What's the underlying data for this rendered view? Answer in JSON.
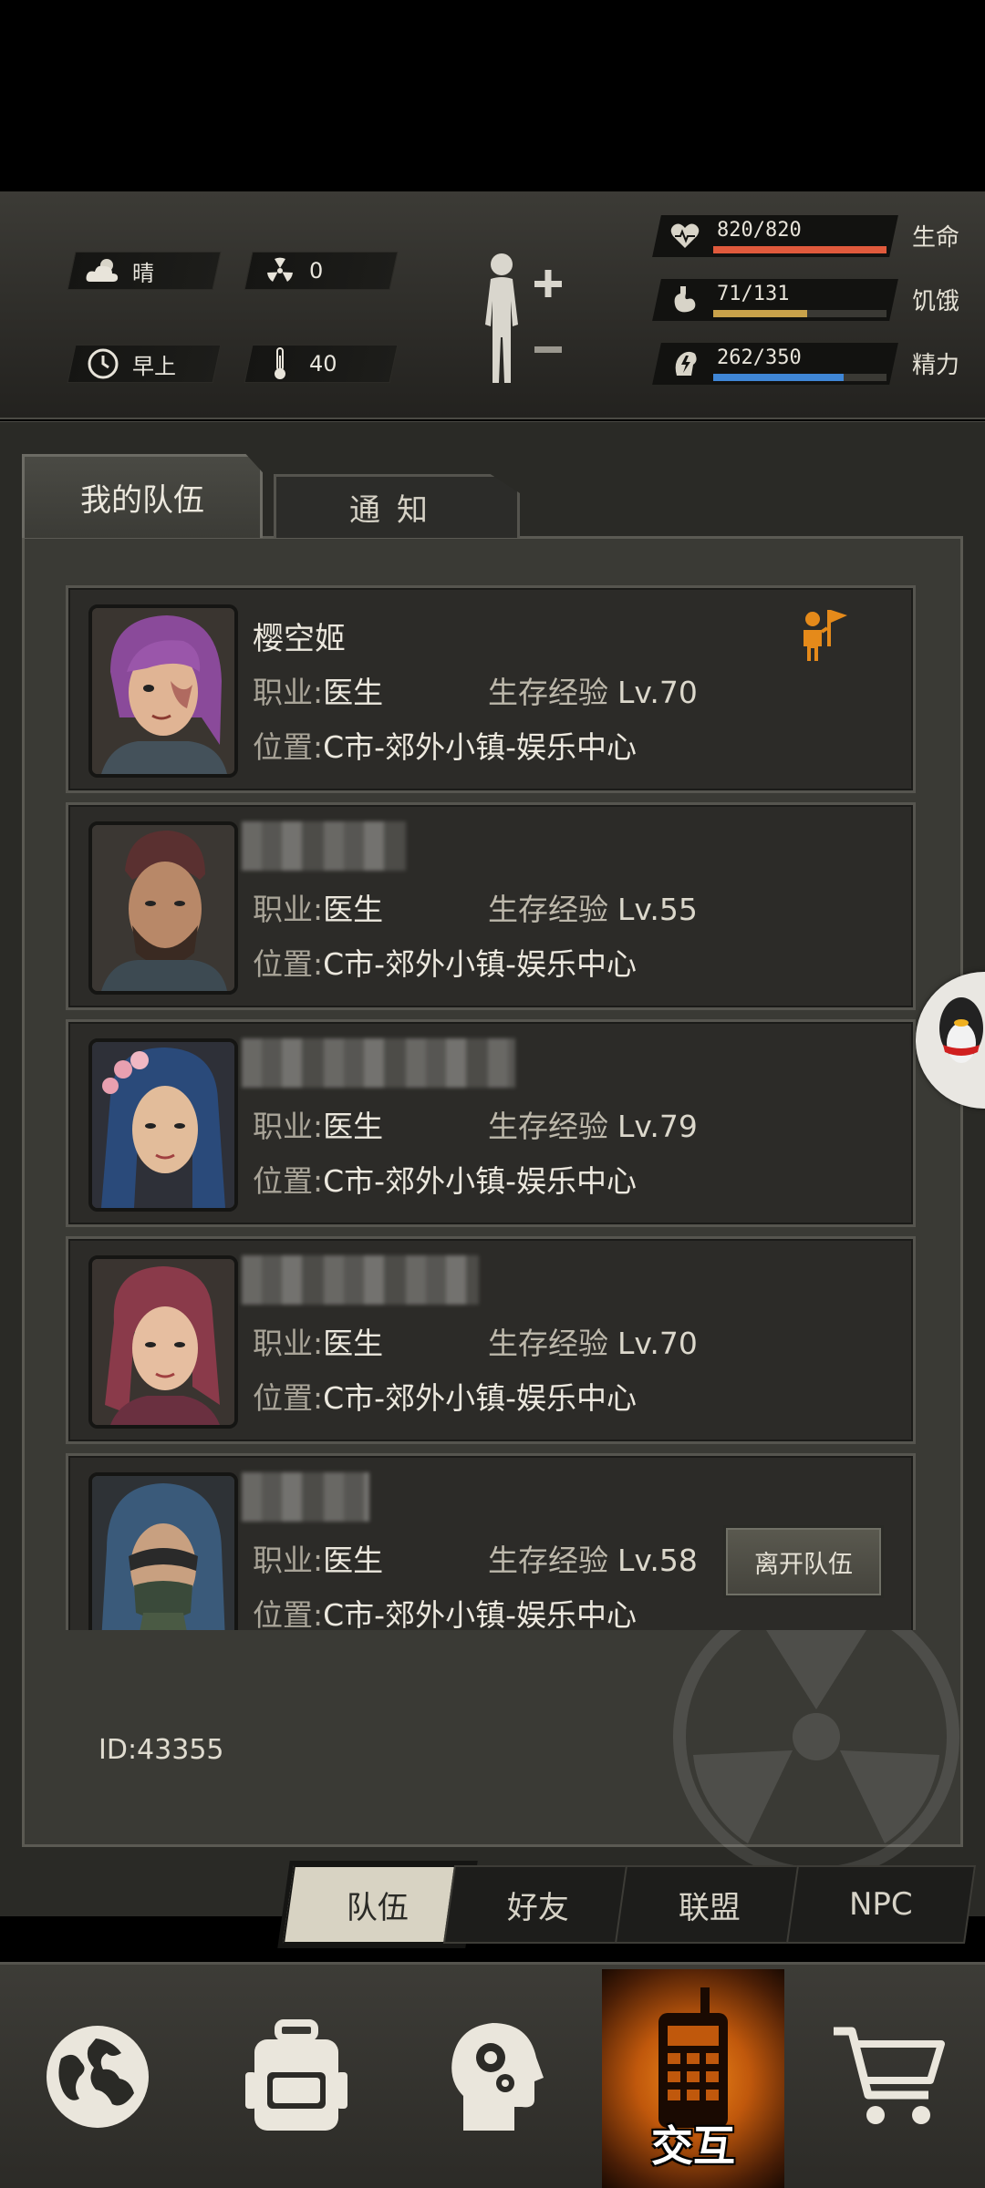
{
  "status": {
    "weather": "晴",
    "radiation": "0",
    "time_of_day": "早上",
    "temperature": "40",
    "vitals": [
      {
        "label": "生命",
        "value": "820/820",
        "fraction": 1.0,
        "color": "#e05a3c"
      },
      {
        "label": "饥饿",
        "value": "71/131",
        "fraction": 0.54,
        "color": "#c9a24a"
      },
      {
        "label": "精力",
        "value": "262/350",
        "fraction": 0.75,
        "color": "#3f86d6"
      }
    ]
  },
  "tabs": {
    "active": "我的队伍",
    "other": "通知"
  },
  "labels": {
    "job": "职业:",
    "location": "位置:",
    "exp": "生存经验",
    "leave": "离开队伍"
  },
  "members": [
    {
      "name": "樱空姬",
      "job": "医生",
      "level": "Lv.70",
      "location": "C市-郊外小镇-娱乐中心",
      "leader": true
    },
    {
      "name": "",
      "job": "医生",
      "level": "Lv.55",
      "location": "C市-郊外小镇-娱乐中心",
      "leader": false
    },
    {
      "name": "",
      "job": "医生",
      "level": "Lv.79",
      "location": "C市-郊外小镇-娱乐中心",
      "leader": false
    },
    {
      "name": "",
      "job": "医生",
      "level": "Lv.70",
      "location": "C市-郊外小镇-娱乐中心",
      "leader": false
    },
    {
      "name": "",
      "job": "医生",
      "level": "Lv.58",
      "location": "C市-郊外小镇-娱乐中心",
      "leader": false
    }
  ],
  "player_id": "ID:43355",
  "subtabs": [
    "队伍",
    "好友",
    "联盟",
    "NPC"
  ],
  "bottom_nav": {
    "active_label": "交互"
  },
  "icons": [
    "cloud-sun-icon",
    "radiation-icon",
    "clock-icon",
    "thermometer-icon",
    "heart-icon",
    "stomach-icon",
    "energy-icon",
    "leader-flag-icon",
    "globe-icon",
    "backpack-icon",
    "skills-head-icon",
    "radio-icon",
    "cart-icon"
  ]
}
